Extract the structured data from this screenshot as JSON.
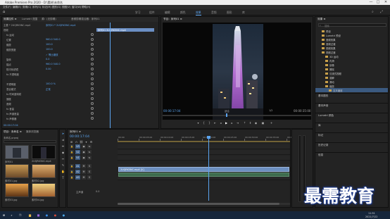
{
  "window": {
    "title": "Adobe Premiere Pro 2020 - D:\\素材\\未命名",
    "minimize": "—",
    "maximize": "□",
    "close": "✕"
  },
  "menu": [
    "文件(F)",
    "编辑(E)",
    "剪辑(C)",
    "序列(S)",
    "标记(M)",
    "图形(G)",
    "视图(V)",
    "窗口(W)",
    "帮助(H)"
  ],
  "workspaces": [
    "学习",
    "组件",
    "编辑",
    "颜色",
    "效果",
    "音频",
    "图形",
    "库"
  ],
  "active_workspace": "效果",
  "effect_controls": {
    "tabs": [
      "效果控件 ≡",
      "Lumetri 范围",
      "源：(无剪辑)",
      "音频剪辑混合器：序列01"
    ],
    "clip_label": "主要 * 2UQRK5NC.mp4",
    "seq_label": "序列01 * 2UQRK5NC.mp4",
    "clip_bar": "序列01 2UQRK5NC.mp4",
    "section_video": "视频",
    "rows": [
      {
        "label": "fx 运动",
        "value": ""
      },
      {
        "label": "位置",
        "value": "960.0   540.0"
      },
      {
        "label": "缩放",
        "value": "100.0"
      },
      {
        "label": "缩放宽度",
        "value": "100.0"
      },
      {
        "label": "",
        "value": "✓ 等比缩放"
      },
      {
        "label": "旋转",
        "value": "0.0"
      },
      {
        "label": "锚点",
        "value": "960.0   540.0"
      },
      {
        "label": "防闪烁滤镜",
        "value": "0.00"
      },
      {
        "label": "fx 不透明度",
        "value": ""
      },
      {
        "label": "",
        "value": ""
      },
      {
        "label": "不透明度",
        "value": "100.0 %"
      },
      {
        "label": "混合模式",
        "value": "正常"
      },
      {
        "label": "fx 时间重映射",
        "value": ""
      },
      {
        "label": "速度",
        "value": ""
      },
      {
        "label": "音频",
        "value": ""
      },
      {
        "label": "fx 音量",
        "value": ""
      },
      {
        "label": "fx 声道音量",
        "value": ""
      },
      {
        "label": "fx 声像器",
        "value": ""
      }
    ],
    "timecode": "00:00:17:04"
  },
  "program": {
    "title": "节目：序列01 ≡",
    "timecode_left": "00:00:17:04",
    "fit": "适合",
    "quality": "1/2",
    "timecode_right": "00:00:35:00"
  },
  "effects_panel": {
    "title": "效果 ≡",
    "search_placeholder": "搜索",
    "tree": [
      {
        "label": "预设",
        "indent": 1,
        "selected": false
      },
      {
        "label": "Lumetri 预设",
        "indent": 1,
        "selected": false
      },
      {
        "label": "音频效果",
        "indent": 1,
        "selected": false
      },
      {
        "label": "音频过渡",
        "indent": 1,
        "selected": false
      },
      {
        "label": "视频效果",
        "indent": 1,
        "selected": false
      },
      {
        "label": "视频过渡",
        "indent": 1,
        "selected": false
      },
      {
        "label": "3D 运动",
        "indent": 2,
        "selected": false
      },
      {
        "label": "内滑",
        "indent": 2,
        "selected": false
      },
      {
        "label": "划像",
        "indent": 2,
        "selected": false
      },
      {
        "label": "擦除",
        "indent": 2,
        "selected": false
      },
      {
        "label": "沉浸式视频",
        "indent": 2,
        "selected": false
      },
      {
        "label": "溶解",
        "indent": 2,
        "selected": false
      },
      {
        "label": "滑动",
        "indent": 2,
        "selected": false
      },
      {
        "label": "缩放",
        "indent": 2,
        "selected": false
      },
      {
        "label": "交叉缩放",
        "indent": 3,
        "selected": true
      }
    ],
    "panels": [
      "基本图形",
      "基本声音",
      "Lumetri 颜色",
      "库",
      "标记",
      "历史记录",
      "信息"
    ]
  },
  "project": {
    "tabs": [
      "项目：未命名 ≡",
      "媒体浏览器"
    ],
    "path": "未命名.prproj",
    "items": [
      "序列01",
      "2UQRK5NC.mp4",
      "素材01.jpg",
      "素材02.jpg",
      "素材03.jpg",
      "素材04.jpg"
    ]
  },
  "timeline": {
    "title": "序列01 ≡",
    "timecode": "00:00:17:04",
    "ruler": [
      "00:00",
      "00:00:05:00",
      "00:00:10:00",
      "00:00:15:00",
      "00:00:20:00",
      "00:00:25:00",
      "00:00:30:00",
      "00:00:35:00",
      "00:00:40:00"
    ],
    "video_tracks": [
      "V3",
      "V2",
      "V1"
    ],
    "audio_tracks": [
      "A1",
      "A2",
      "A3"
    ],
    "clip_label": "2UQRK5NC.mp4 [V]",
    "master": "主声道",
    "master_value": "0.0"
  },
  "watermark": "最需教育",
  "taskbar": {
    "time": "11:51",
    "date": "2021/7/22"
  }
}
